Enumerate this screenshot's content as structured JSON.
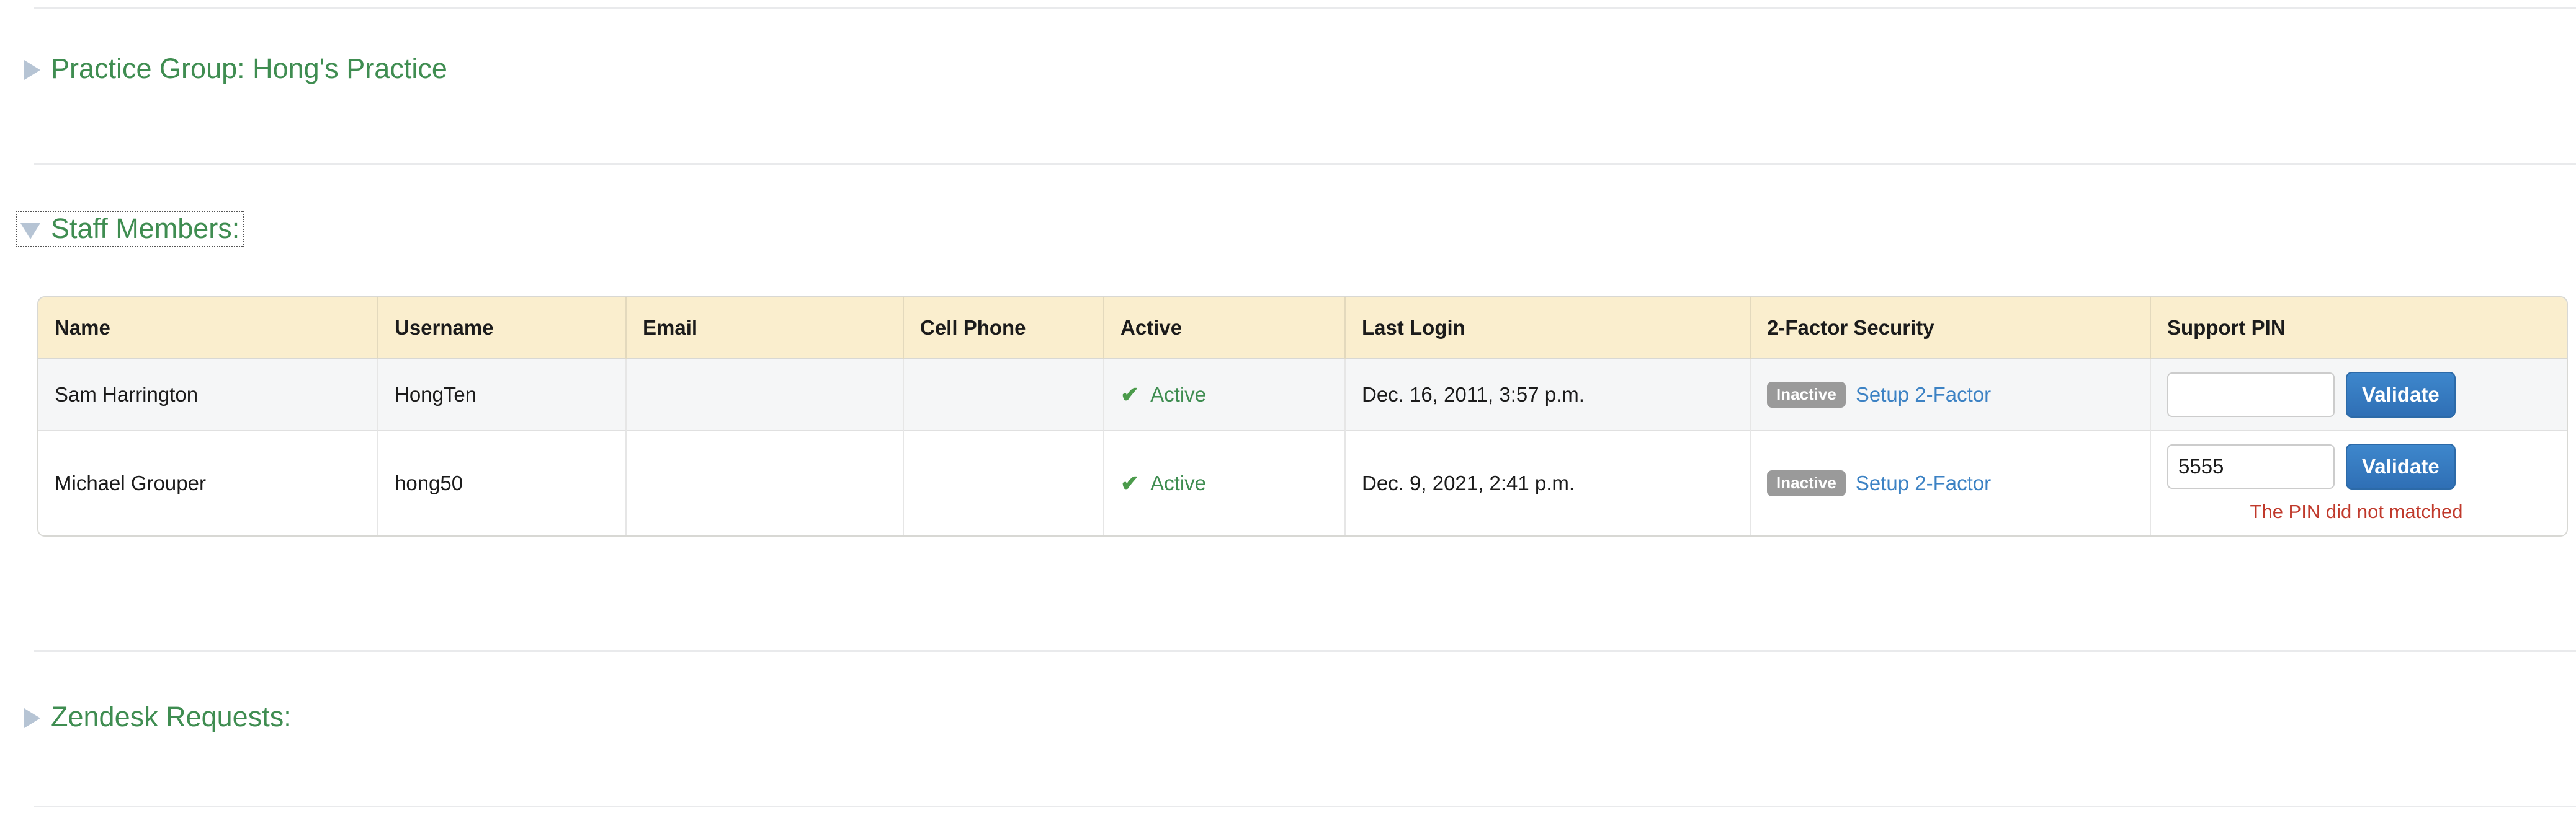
{
  "sections": [
    {
      "id": "practice-group",
      "title": "Practice Group: Hong's Practice",
      "caret": "triangle-right-icon",
      "expanded": false
    },
    {
      "id": "staff-members",
      "title": "Staff Members:",
      "caret": "triangle-down-icon",
      "expanded": true
    },
    {
      "id": "zendesk-requests",
      "title": "Zendesk Requests:",
      "caret": "triangle-right-icon",
      "expanded": false
    }
  ],
  "staff_table": {
    "columns": [
      "Name",
      "Username",
      "Email",
      "Cell Phone",
      "Active",
      "Last Login",
      "2-Factor Security",
      "Support PIN"
    ],
    "rows": [
      {
        "name": "Sam Harrington",
        "username": "HongTen",
        "email": "",
        "cell_phone": "",
        "active_label": "Active",
        "active_icon": "check-icon",
        "last_login": "Dec. 16, 2011, 3:57 p.m.",
        "two_factor_badge": "Inactive",
        "two_factor_link": "Setup 2-Factor",
        "pin_value": "",
        "pin_button": "Validate",
        "pin_error": ""
      },
      {
        "name": "Michael Grouper",
        "username": "hong50",
        "email": "",
        "cell_phone": "",
        "active_label": "Active",
        "active_icon": "check-icon",
        "last_login": "Dec. 9, 2021, 2:41 p.m.",
        "two_factor_badge": "Inactive",
        "two_factor_link": "Setup 2-Factor",
        "pin_value": "5555",
        "pin_button": "Validate",
        "pin_error": "The PIN did not matched"
      }
    ]
  },
  "colors": {
    "section_title": "#3f8d51",
    "header_bg": "#faeece",
    "badge_gray": "#9a9a9a",
    "link_blue": "#3c82c4",
    "button_blue": "#2f6fb5",
    "error_red": "#c0392b",
    "active_green": "#3f8d51"
  }
}
